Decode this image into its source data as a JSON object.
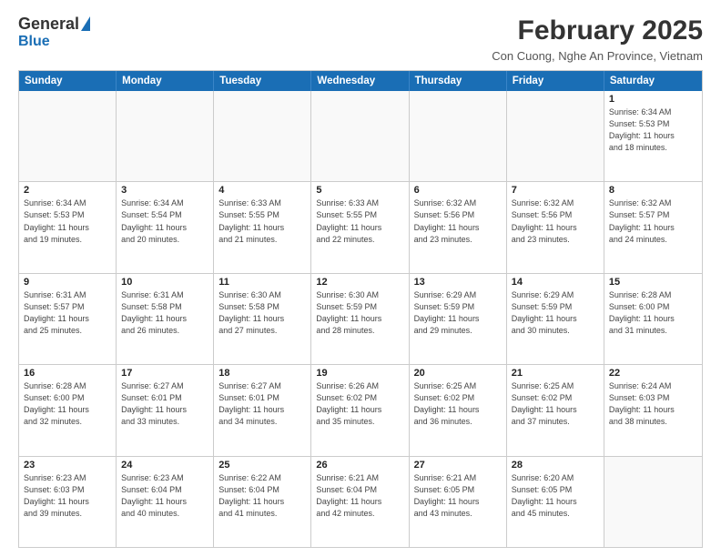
{
  "header": {
    "logo_general": "General",
    "logo_blue": "Blue",
    "month_title": "February 2025",
    "location": "Con Cuong, Nghe An Province, Vietnam"
  },
  "days_of_week": [
    "Sunday",
    "Monday",
    "Tuesday",
    "Wednesday",
    "Thursday",
    "Friday",
    "Saturday"
  ],
  "weeks": [
    [
      {
        "day": "",
        "info": ""
      },
      {
        "day": "",
        "info": ""
      },
      {
        "day": "",
        "info": ""
      },
      {
        "day": "",
        "info": ""
      },
      {
        "day": "",
        "info": ""
      },
      {
        "day": "",
        "info": ""
      },
      {
        "day": "1",
        "info": "Sunrise: 6:34 AM\nSunset: 5:53 PM\nDaylight: 11 hours\nand 18 minutes."
      }
    ],
    [
      {
        "day": "2",
        "info": "Sunrise: 6:34 AM\nSunset: 5:53 PM\nDaylight: 11 hours\nand 19 minutes."
      },
      {
        "day": "3",
        "info": "Sunrise: 6:34 AM\nSunset: 5:54 PM\nDaylight: 11 hours\nand 20 minutes."
      },
      {
        "day": "4",
        "info": "Sunrise: 6:33 AM\nSunset: 5:55 PM\nDaylight: 11 hours\nand 21 minutes."
      },
      {
        "day": "5",
        "info": "Sunrise: 6:33 AM\nSunset: 5:55 PM\nDaylight: 11 hours\nand 22 minutes."
      },
      {
        "day": "6",
        "info": "Sunrise: 6:32 AM\nSunset: 5:56 PM\nDaylight: 11 hours\nand 23 minutes."
      },
      {
        "day": "7",
        "info": "Sunrise: 6:32 AM\nSunset: 5:56 PM\nDaylight: 11 hours\nand 23 minutes."
      },
      {
        "day": "8",
        "info": "Sunrise: 6:32 AM\nSunset: 5:57 PM\nDaylight: 11 hours\nand 24 minutes."
      }
    ],
    [
      {
        "day": "9",
        "info": "Sunrise: 6:31 AM\nSunset: 5:57 PM\nDaylight: 11 hours\nand 25 minutes."
      },
      {
        "day": "10",
        "info": "Sunrise: 6:31 AM\nSunset: 5:58 PM\nDaylight: 11 hours\nand 26 minutes."
      },
      {
        "day": "11",
        "info": "Sunrise: 6:30 AM\nSunset: 5:58 PM\nDaylight: 11 hours\nand 27 minutes."
      },
      {
        "day": "12",
        "info": "Sunrise: 6:30 AM\nSunset: 5:59 PM\nDaylight: 11 hours\nand 28 minutes."
      },
      {
        "day": "13",
        "info": "Sunrise: 6:29 AM\nSunset: 5:59 PM\nDaylight: 11 hours\nand 29 minutes."
      },
      {
        "day": "14",
        "info": "Sunrise: 6:29 AM\nSunset: 5:59 PM\nDaylight: 11 hours\nand 30 minutes."
      },
      {
        "day": "15",
        "info": "Sunrise: 6:28 AM\nSunset: 6:00 PM\nDaylight: 11 hours\nand 31 minutes."
      }
    ],
    [
      {
        "day": "16",
        "info": "Sunrise: 6:28 AM\nSunset: 6:00 PM\nDaylight: 11 hours\nand 32 minutes."
      },
      {
        "day": "17",
        "info": "Sunrise: 6:27 AM\nSunset: 6:01 PM\nDaylight: 11 hours\nand 33 minutes."
      },
      {
        "day": "18",
        "info": "Sunrise: 6:27 AM\nSunset: 6:01 PM\nDaylight: 11 hours\nand 34 minutes."
      },
      {
        "day": "19",
        "info": "Sunrise: 6:26 AM\nSunset: 6:02 PM\nDaylight: 11 hours\nand 35 minutes."
      },
      {
        "day": "20",
        "info": "Sunrise: 6:25 AM\nSunset: 6:02 PM\nDaylight: 11 hours\nand 36 minutes."
      },
      {
        "day": "21",
        "info": "Sunrise: 6:25 AM\nSunset: 6:02 PM\nDaylight: 11 hours\nand 37 minutes."
      },
      {
        "day": "22",
        "info": "Sunrise: 6:24 AM\nSunset: 6:03 PM\nDaylight: 11 hours\nand 38 minutes."
      }
    ],
    [
      {
        "day": "23",
        "info": "Sunrise: 6:23 AM\nSunset: 6:03 PM\nDaylight: 11 hours\nand 39 minutes."
      },
      {
        "day": "24",
        "info": "Sunrise: 6:23 AM\nSunset: 6:04 PM\nDaylight: 11 hours\nand 40 minutes."
      },
      {
        "day": "25",
        "info": "Sunrise: 6:22 AM\nSunset: 6:04 PM\nDaylight: 11 hours\nand 41 minutes."
      },
      {
        "day": "26",
        "info": "Sunrise: 6:21 AM\nSunset: 6:04 PM\nDaylight: 11 hours\nand 42 minutes."
      },
      {
        "day": "27",
        "info": "Sunrise: 6:21 AM\nSunset: 6:05 PM\nDaylight: 11 hours\nand 43 minutes."
      },
      {
        "day": "28",
        "info": "Sunrise: 6:20 AM\nSunset: 6:05 PM\nDaylight: 11 hours\nand 45 minutes."
      },
      {
        "day": "",
        "info": ""
      }
    ]
  ]
}
